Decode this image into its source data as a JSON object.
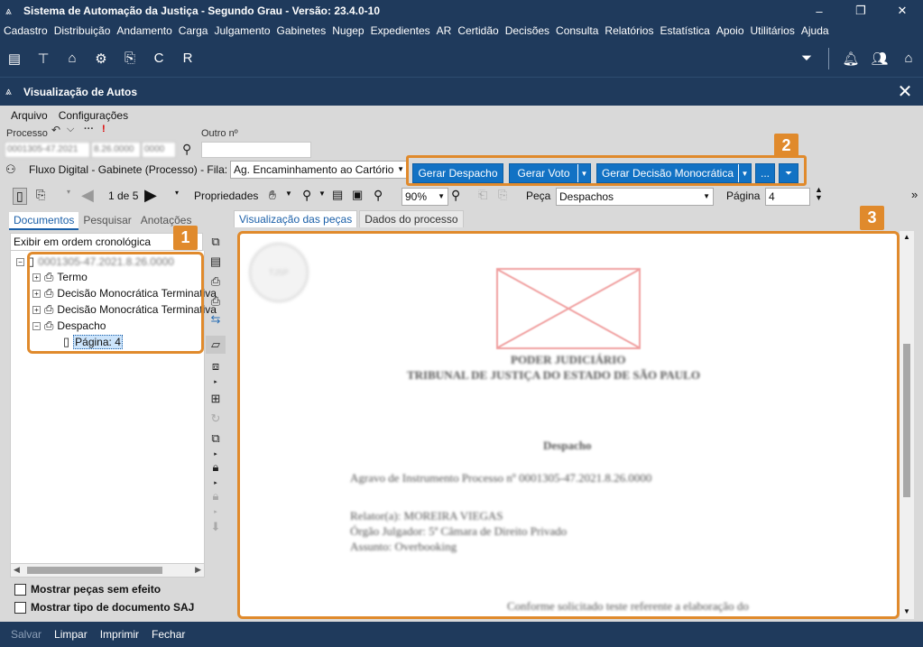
{
  "app": {
    "title": "Sistema de Automação da Justiça - Segundo Grau - Versão: 23.4.0-10",
    "window_controls": [
      "–",
      "❐",
      "✕"
    ]
  },
  "menu": [
    "Cadastro",
    "Distribuição",
    "Andamento",
    "Carga",
    "Julgamento",
    "Gabinetes",
    "Nugep",
    "Expedientes",
    "AR",
    "Certidão",
    "Decisões",
    "Consulta",
    "Relatórios",
    "Estatística",
    "Apoio",
    "Utilitários",
    "Ajuda"
  ],
  "inner_window": {
    "title": "Visualização de Autos",
    "menu": [
      "Arquivo",
      "Configurações"
    ]
  },
  "form": {
    "processo_label": "Processo",
    "processo_value_1": "0001305-47.2021",
    "processo_value_2": "8.26.0000",
    "processo_value_3": "0000",
    "outro_label": "Outro nº",
    "outro_value": "",
    "fluxo_label": "Fluxo Digital - Gabinete (Processo) - Fila:",
    "fila_value": "Ag. Encaminhamento ao Cartório"
  },
  "action_buttons": {
    "gerar_despacho": "Gerar Despacho",
    "gerar_voto": "Gerar Voto",
    "gerar_decisao": "Gerar Decisão Monocrática",
    "more": "...",
    "filter": "⏷"
  },
  "badges": {
    "one": "1",
    "two": "2",
    "three": "3"
  },
  "toolbar": {
    "page_of": "1 de 5",
    "propriedades": "Propriedades",
    "zoom": "90%",
    "peca_label": "Peça",
    "peca_value": "Despachos",
    "pagina_label": "Página",
    "pagina_value": "4"
  },
  "left": {
    "tabs": [
      "Documentos",
      "Pesquisar",
      "Anotações"
    ],
    "order": "Exibir em ordem cronológica",
    "tree": {
      "root": "0001305-47.2021.8.26.0000",
      "items": [
        "Termo",
        "Decisão Monocrática Terminativa",
        "Decisão Monocrática Terminativa",
        "Despacho"
      ],
      "child": "Página: 4"
    },
    "checkboxes": [
      "Mostrar peças sem efeito",
      "Mostrar tipo de documento SAJ"
    ]
  },
  "right": {
    "tabs": [
      "Visualização das peças",
      "Dados do processo"
    ],
    "document": {
      "seal": "TJSP",
      "header1": "PODER JUDICIÁRIO",
      "header2": "TRIBUNAL DE JUSTIÇA DO ESTADO DE SÃO PAULO",
      "doc_title": "Despacho",
      "line1": "Agravo de Instrumento     Processo nº 0001305-47.2021.8.26.0000",
      "line2": "Relator(a): MOREIRA VIEGAS",
      "line3": "Órgão Julgador: 5ª Câmara de Direito Privado",
      "line4": "Assunto: Overbooking",
      "line5": "Conforme solicitado teste referente a elaboração do"
    }
  },
  "bottom": [
    "Salvar",
    "Limpar",
    "Imprimir",
    "Fechar"
  ],
  "colors": {
    "navy": "#1f3a5c",
    "accent_orange": "#e08a2c",
    "button_blue": "#1272c4"
  }
}
